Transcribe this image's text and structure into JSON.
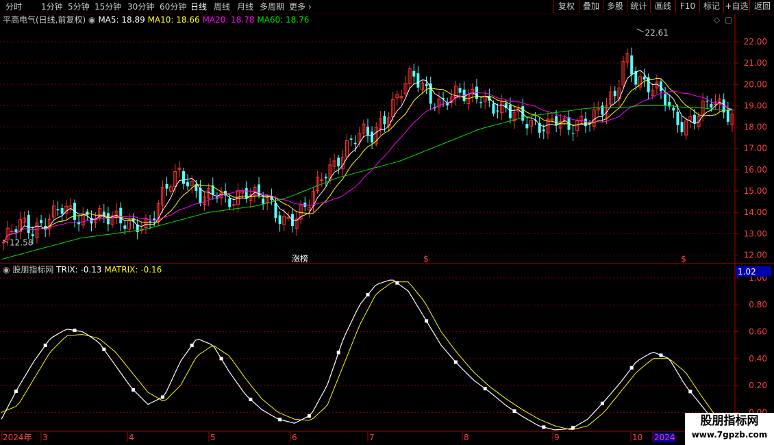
{
  "toolbar": {
    "periods": [
      "分时",
      "1分钟",
      "5分钟",
      "15分钟",
      "30分钟",
      "60分钟",
      "日线",
      "周线",
      "月线",
      "多周期",
      "更多"
    ],
    "active_period": "日线",
    "right_buttons": [
      "复权",
      "叠加",
      "多股",
      "统计",
      "画线",
      "F10",
      "标记",
      "+自选",
      "返回"
    ]
  },
  "main_panel": {
    "stock_title": "平高电气(日线,前复权)",
    "ma5": "MA5: 18.89",
    "ma10": "MA10: 18.66",
    "ma20": "MA20: 18.78",
    "ma60": "MA60: 18.76",
    "high_label": "22.61",
    "low_label": "12.58",
    "event_labels": [
      "涨榜",
      "$",
      "$"
    ],
    "y_axis": [
      "22.00",
      "21.00",
      "20.00",
      "19.00",
      "18.00",
      "17.00",
      "16.00",
      "15.00",
      "14.00",
      "13.00",
      "12.00"
    ]
  },
  "indicator_panel": {
    "title": "股朋指标网",
    "trix": "TRIX: -0.13",
    "matrix": "MATRIX: -0.16",
    "value_box": "1.02",
    "y_axis": [
      "1.00",
      "0.80",
      "0.60",
      "0.40",
      "0.20",
      "0.00"
    ]
  },
  "x_axis": [
    "2024年",
    "3",
    "4",
    "5",
    "6",
    "7",
    "8",
    "9",
    "10",
    "2024"
  ],
  "watermark": {
    "line1": "股朋指标网",
    "line2": "www.7gpzb.com"
  },
  "colors": {
    "up": "#ff3232",
    "down": "#54ffff",
    "ma5": "#ffffff",
    "ma10": "#ffff00",
    "ma20": "#ff00ff",
    "ma60": "#00e000",
    "grid": "#7a0000",
    "axis_text": "#ff4040"
  },
  "chart_data": [
    {
      "type": "candlestick",
      "title": "平高电气(日线,前复权)",
      "ylim": [
        11.6,
        22.8
      ],
      "y_ticks": [
        12,
        13,
        14,
        15,
        16,
        17,
        18,
        19,
        20,
        21,
        22
      ],
      "x_labels": [
        "2024年",
        "3",
        "4",
        "5",
        "6",
        "7",
        "8",
        "9",
        "10",
        "2024"
      ],
      "high": 22.61,
      "low": 12.58,
      "close_path": [
        12.6,
        13.1,
        13.4,
        13.2,
        13.6,
        13.9,
        14.1,
        13.8,
        13.7,
        14.0,
        13.9,
        13.6,
        13.5,
        13.4,
        13.6,
        13.5,
        14.3,
        15.2,
        15.9,
        15.6,
        14.9,
        14.6,
        14.8,
        14.4,
        14.9,
        15.1,
        14.7,
        14.5,
        13.9,
        13.7,
        13.9,
        14.1,
        14.8,
        15.8,
        16.3,
        17.0,
        17.4,
        17.6,
        17.5,
        18.4,
        19.1,
        19.8,
        20.3,
        19.9,
        19.4,
        19.2,
        19.5,
        19.4,
        19.3,
        19.6,
        19.2,
        18.9,
        18.6,
        18.4,
        18.3,
        18.2,
        18.1,
        18.3,
        17.7,
        18.2,
        18.5,
        18.7,
        18.9,
        19.3,
        21.4,
        20.5,
        20.1,
        19.7,
        19.3,
        18.4,
        18.2,
        18.5,
        18.8,
        19.1,
        18.8,
        18.6
      ],
      "ma60_path": [
        11.8,
        12.0,
        12.2,
        12.4,
        12.6,
        12.8,
        12.9,
        13.0,
        13.1,
        13.2,
        13.4,
        13.6,
        13.8,
        14.0,
        14.1,
        14.2,
        14.3,
        14.5,
        14.7,
        15.0,
        15.3,
        15.6,
        15.8,
        16.0,
        16.2,
        16.4,
        16.7,
        17.0,
        17.3,
        17.6,
        17.9,
        18.1,
        18.3,
        18.5,
        18.6,
        18.7,
        18.8,
        18.9,
        18.9,
        18.9,
        19.0,
        19.0,
        19.0,
        18.9,
        18.9,
        18.8,
        18.8
      ]
    },
    {
      "type": "line",
      "title": "股朋指标网",
      "ylim": [
        -0.13,
        1.02
      ],
      "y_ticks": [
        0,
        0.2,
        0.4,
        0.6,
        0.8,
        1.0
      ],
      "series": [
        {
          "name": "TRIX",
          "values": [
            -0.05,
            0.18,
            0.38,
            0.55,
            0.62,
            0.6,
            0.52,
            0.35,
            0.18,
            0.06,
            0.12,
            0.38,
            0.55,
            0.5,
            0.3,
            0.13,
            0.02,
            -0.05,
            -0.08,
            -0.02,
            0.2,
            0.55,
            0.8,
            0.95,
            0.99,
            0.9,
            0.7,
            0.5,
            0.36,
            0.24,
            0.15,
            0.05,
            -0.03,
            -0.1,
            -0.13,
            -0.12,
            -0.05,
            0.08,
            0.22,
            0.38,
            0.45,
            0.4,
            0.2,
            0.05,
            -0.1,
            -0.13
          ]
        },
        {
          "name": "MATRIX",
          "values": [
            0.0,
            0.05,
            0.25,
            0.45,
            0.57,
            0.58,
            0.55,
            0.45,
            0.3,
            0.15,
            0.08,
            0.2,
            0.42,
            0.5,
            0.42,
            0.25,
            0.1,
            0.0,
            -0.05,
            -0.06,
            0.05,
            0.35,
            0.65,
            0.88,
            0.97,
            0.97,
            0.82,
            0.6,
            0.44,
            0.3,
            0.19,
            0.1,
            0.02,
            -0.05,
            -0.1,
            -0.13,
            -0.1,
            0.0,
            0.15,
            0.3,
            0.4,
            0.4,
            0.3,
            0.12,
            -0.05,
            -0.16
          ]
        }
      ]
    }
  ]
}
